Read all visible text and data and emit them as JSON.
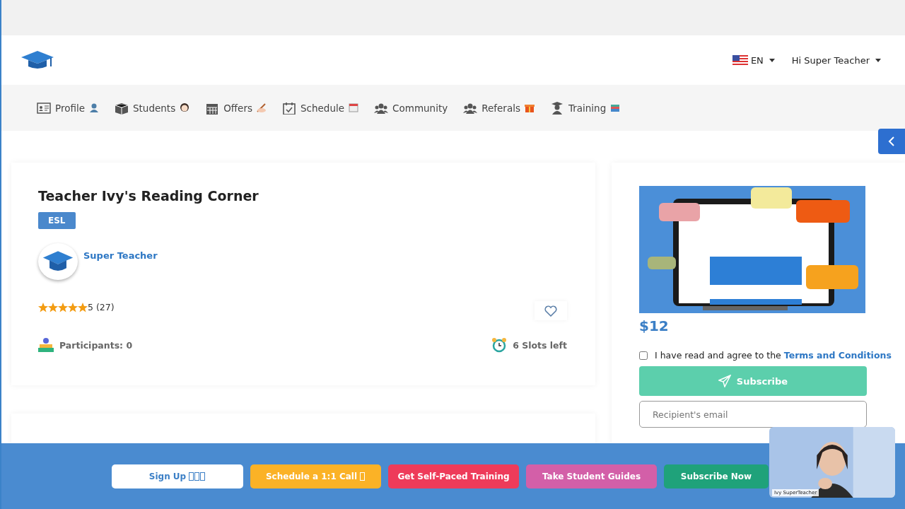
{
  "header": {
    "language": "EN",
    "user_menu": "Hi Super Teacher"
  },
  "nav": [
    {
      "label": "Profile"
    },
    {
      "label": "Students"
    },
    {
      "label": "Offers"
    },
    {
      "label": "Schedule"
    },
    {
      "label": "Community"
    },
    {
      "label": "Referals"
    },
    {
      "label": "Training"
    }
  ],
  "offer": {
    "title": "Teacher Ivy's Reading Corner",
    "tag": "ESL",
    "teacher": "Super Teacher",
    "stars": 5,
    "rating": "5 (27)",
    "participants": "Participants: 0",
    "slots": "6 Slots left"
  },
  "purchase": {
    "price": "$12",
    "terms_checked": false,
    "terms_text": "I have read and agree to the",
    "terms_link": "Terms and Conditions",
    "subscribe_button": "Subscribe",
    "email_placeholder": "Recipient's email"
  },
  "bottom_bar": [
    {
      "label": "Sign Up",
      "color": "#ffffff"
    },
    {
      "label": "Schedule a 1:1 Call",
      "color": "#fbb226"
    },
    {
      "label": "Get Self-Paced Training",
      "color": "#ee3b5a"
    },
    {
      "label": "Take Student Guides",
      "color": "#d35fa8"
    },
    {
      "label": "Subscribe Now",
      "color": "#1fa27a"
    }
  ],
  "video": {
    "caption": "Ivy SuperTeacher"
  }
}
